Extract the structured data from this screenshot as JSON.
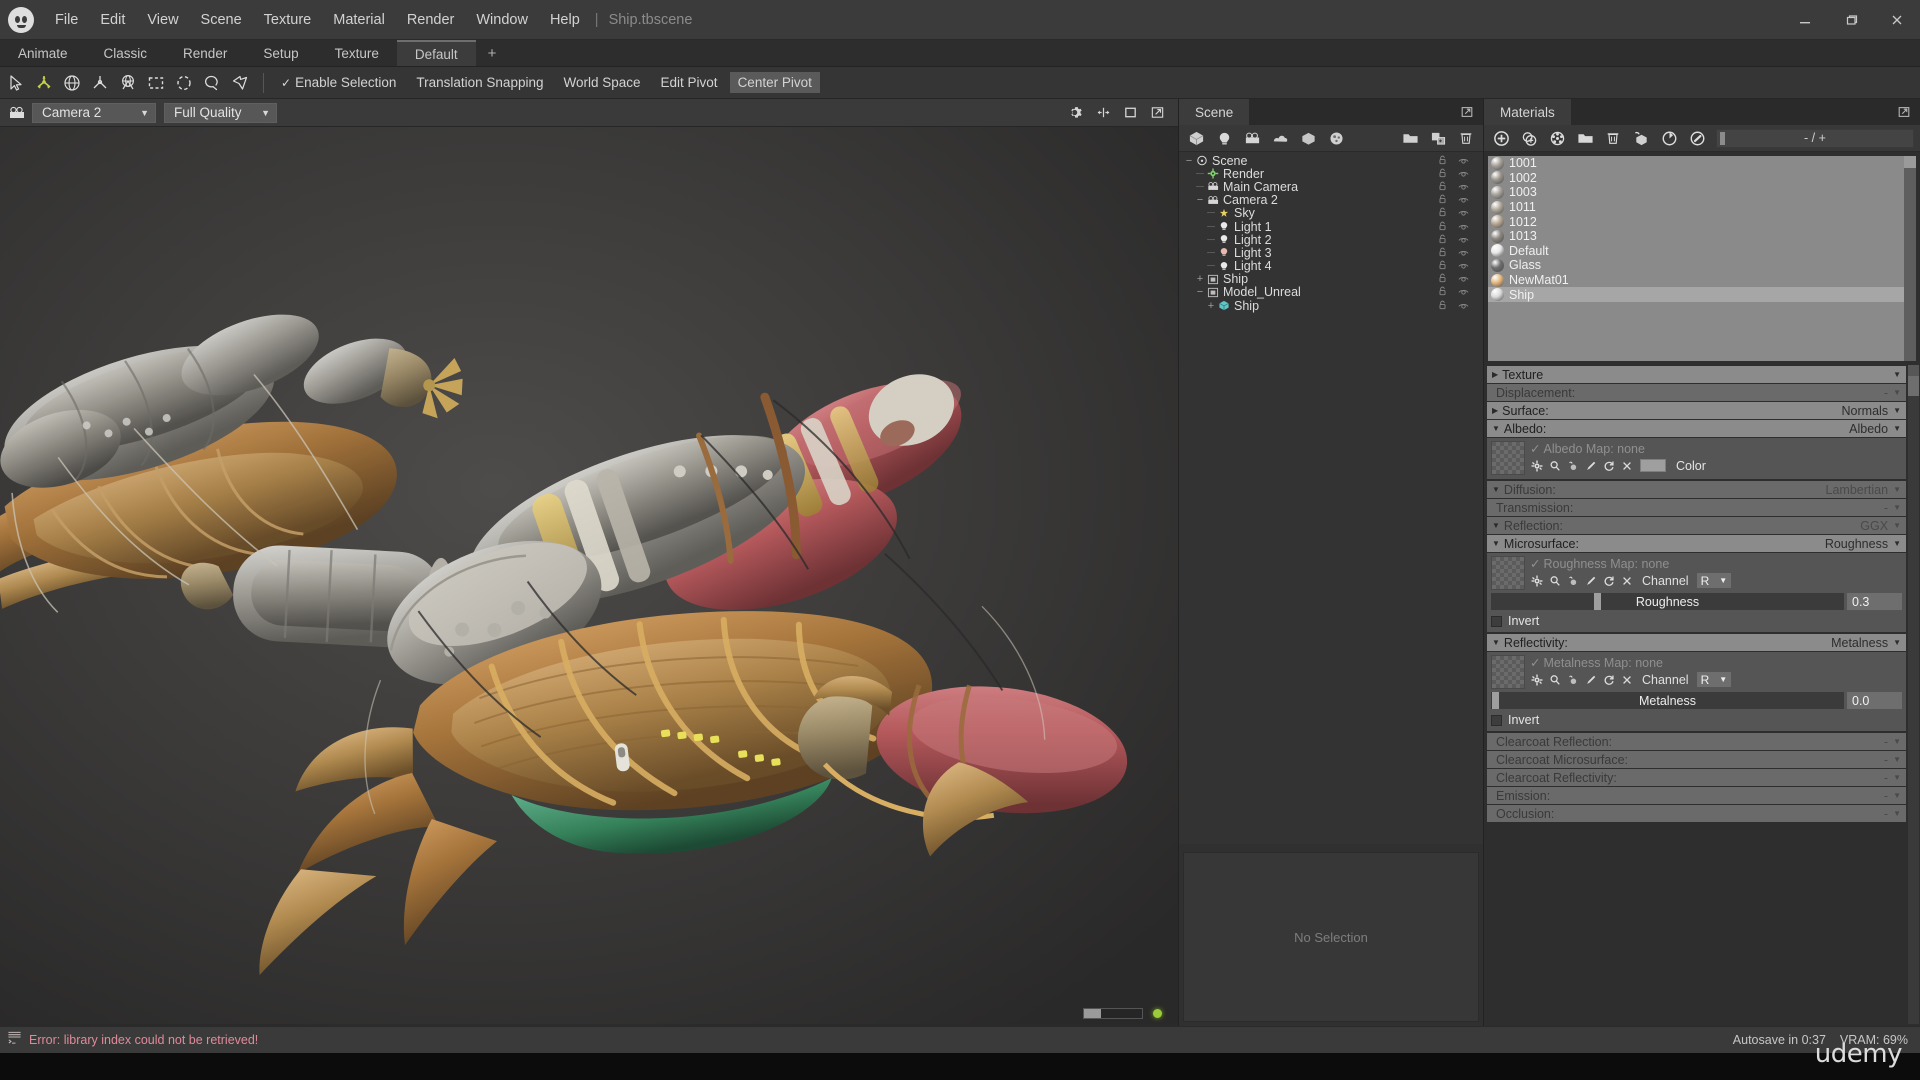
{
  "app": {
    "title": "Ship.tbscene",
    "separator": "|"
  },
  "menubar": {
    "items": [
      "File",
      "Edit",
      "View",
      "Scene",
      "Texture",
      "Material",
      "Render",
      "Window",
      "Help"
    ]
  },
  "window_controls": {
    "minimize": "minimize-icon",
    "maximize": "maximize-icon",
    "close": "close-icon"
  },
  "layout_tabs": {
    "items": [
      "Animate",
      "Classic",
      "Render",
      "Setup",
      "Texture",
      "Default"
    ],
    "active": "Default",
    "add_label": "+"
  },
  "toolbar": {
    "tools": [
      {
        "name": "select-arrow-tool",
        "icon": "cursor-arrow-icon"
      },
      {
        "name": "translate-tool",
        "icon": "translate-axis-icon"
      },
      {
        "name": "rotate-tool",
        "icon": "rotate-globe-icon"
      },
      {
        "name": "scale-tool",
        "icon": "scale-icon"
      },
      {
        "name": "transform-tool",
        "icon": "transform-globe-icon"
      },
      {
        "name": "rect-select-tool",
        "icon": "rectangle-marquee-icon"
      },
      {
        "name": "ellipse-select-tool",
        "icon": "ellipse-marquee-icon"
      },
      {
        "name": "lasso-select-tool",
        "icon": "lasso-icon"
      },
      {
        "name": "polygon-select-tool",
        "icon": "polygon-lasso-icon"
      }
    ],
    "toggles": [
      {
        "label": "Enable Selection",
        "checked": true,
        "pressed": false
      },
      {
        "label": "Translation Snapping",
        "checked": false,
        "pressed": false
      },
      {
        "label": "World Space",
        "checked": false,
        "pressed": false
      },
      {
        "label": "Edit Pivot",
        "checked": false,
        "pressed": false
      },
      {
        "label": "Center Pivot",
        "checked": false,
        "pressed": true
      }
    ]
  },
  "viewport": {
    "camera_select": {
      "value": "Camera 2",
      "caret": "▼"
    },
    "quality_select": {
      "value": "Full Quality",
      "caret": "▼"
    },
    "header_icons": [
      "gear-icon",
      "split-view-icon",
      "square-icon",
      "popout-icon"
    ],
    "progress_percent": 30,
    "status_dot_color": "#9ccc3a"
  },
  "scene_panel": {
    "tab_label": "Scene",
    "toolbar_icons": [
      "add-mesh-icon",
      "add-light-icon",
      "add-camera-icon",
      "add-sky-icon",
      "add-object-icon",
      "add-material-icon",
      "folder-icon",
      "duplicate-icon",
      "trash-icon"
    ],
    "tree": [
      {
        "label": "Scene",
        "depth": 0,
        "toggle": "−",
        "icon": "scene-root-icon",
        "iconColor": "#d9d9d9"
      },
      {
        "label": "Render",
        "depth": 1,
        "toggle": "",
        "icon": "render-gear-icon",
        "iconColor": "#7fd46b"
      },
      {
        "label": "Main Camera",
        "depth": 1,
        "toggle": "",
        "icon": "camera-icon",
        "iconColor": "#d6d6d6"
      },
      {
        "label": "Camera 2",
        "depth": 1,
        "toggle": "−",
        "icon": "camera-icon",
        "iconColor": "#d6d6d6"
      },
      {
        "label": "Sky",
        "depth": 2,
        "toggle": "",
        "icon": "sky-icon",
        "iconColor": "#e8d060"
      },
      {
        "label": "Light 1",
        "depth": 2,
        "toggle": "",
        "icon": "light-bulb-icon",
        "iconColor": "#e9e9e9"
      },
      {
        "label": "Light 2",
        "depth": 2,
        "toggle": "",
        "icon": "light-bulb-icon",
        "iconColor": "#e9e9e9"
      },
      {
        "label": "Light 3",
        "depth": 2,
        "toggle": "",
        "icon": "light-bulb-icon",
        "iconColor": "#e8b9b0"
      },
      {
        "label": "Light 4",
        "depth": 2,
        "toggle": "",
        "icon": "light-bulb-icon",
        "iconColor": "#e9e9e9"
      },
      {
        "label": "Ship",
        "depth": 1,
        "toggle": "+",
        "icon": "group-icon",
        "iconColor": "#bdbdbd"
      },
      {
        "label": "Model_Unreal",
        "depth": 1,
        "toggle": "−",
        "icon": "group-icon",
        "iconColor": "#bdbdbd"
      },
      {
        "label": "Ship",
        "depth": 2,
        "toggle": "+",
        "icon": "mesh-cube-icon",
        "iconColor": "#5ec8c8"
      }
    ],
    "row_icons": {
      "lock": "lock-icon",
      "visibility": "eye-icon"
    },
    "properties_empty": "No Selection"
  },
  "materials_panel": {
    "tab_label": "Materials",
    "toolbar_icons": [
      "add-material-icon",
      "duplicate-material-icon",
      "clear-material-icon",
      "folder-icon",
      "trash-icon",
      "assign-material-icon",
      "preview-sphere-icon",
      "refresh-icon"
    ],
    "search_placeholder": "",
    "counter": "- / +",
    "materials": [
      {
        "label": "1001",
        "color": "#a8a29a",
        "selected": false
      },
      {
        "label": "1002",
        "color": "#9d978e",
        "selected": false
      },
      {
        "label": "1003",
        "color": "#a7a29c",
        "selected": false
      },
      {
        "label": "1011",
        "color": "#b2a99c",
        "selected": false
      },
      {
        "label": "1012",
        "color": "#b9a995",
        "selected": false
      },
      {
        "label": "1013",
        "color": "#8d8880",
        "selected": false
      },
      {
        "label": "Default",
        "color": "#e9e9e9",
        "selected": false
      },
      {
        "label": "Glass",
        "color": "#6f6f6f",
        "selected": false
      },
      {
        "label": "NewMat01",
        "color": "#e6b87f",
        "selected": false
      },
      {
        "label": "Ship",
        "color": "#dcdcdc",
        "selected": true
      }
    ],
    "sections": [
      {
        "key": "texture",
        "title": "Texture",
        "tri": "▶",
        "value": "",
        "dim": false,
        "expanded": false
      },
      {
        "key": "displace",
        "title": "Displacement:",
        "tri": "",
        "value": "-",
        "dim": true,
        "expanded": false
      },
      {
        "key": "surface",
        "title": "Surface:",
        "tri": "▶",
        "value": "Normals",
        "dim": false,
        "expanded": false
      },
      {
        "key": "albedo",
        "title": "Albedo:",
        "tri": "▼",
        "value": "Albedo",
        "dim": false,
        "expanded": true
      },
      {
        "key": "diffusion",
        "title": "Diffusion:",
        "tri": "▼",
        "value": "Lambertian",
        "dim": true,
        "expanded": false
      },
      {
        "key": "transmis",
        "title": "Transmission:",
        "tri": "",
        "value": "-",
        "dim": true,
        "expanded": false
      },
      {
        "key": "reflection",
        "title": "Reflection:",
        "tri": "▼",
        "value": "GGX",
        "dim": true,
        "expanded": false
      },
      {
        "key": "micro",
        "title": "Microsurface:",
        "tri": "▼",
        "value": "Roughness",
        "dim": false,
        "expanded": true
      },
      {
        "key": "reflectiv",
        "title": "Reflectivity:",
        "tri": "▼",
        "value": "Metalness",
        "dim": false,
        "expanded": true
      },
      {
        "key": "ccrefl",
        "title": "Clearcoat Reflection:",
        "tri": "",
        "value": "-",
        "dim": true,
        "expanded": false
      },
      {
        "key": "ccmicro",
        "title": "Clearcoat Microsurface:",
        "tri": "",
        "value": "-",
        "dim": true,
        "expanded": false
      },
      {
        "key": "ccreflect",
        "title": "Clearcoat Reflectivity:",
        "tri": "",
        "value": "-",
        "dim": true,
        "expanded": false
      },
      {
        "key": "emission",
        "title": "Emission:",
        "tri": "",
        "value": "-",
        "dim": true,
        "expanded": false
      },
      {
        "key": "occlusion",
        "title": "Occlusion:",
        "tri": "",
        "value": "-",
        "dim": true,
        "expanded": false
      }
    ],
    "albedo_body": {
      "map_label": "Albedo Map: none",
      "check": "✓",
      "icons": [
        "gear-icon",
        "search-icon",
        "eyedropper-icon",
        "edit-pencil-icon",
        "reload-icon",
        "clear-x-icon"
      ],
      "color_label": "Color",
      "color_value": "#9f9f9f"
    },
    "micro_body": {
      "map_label": "Roughness Map: none",
      "check": "✓",
      "icons": [
        "gear-icon",
        "search-icon",
        "eyedropper-icon",
        "edit-pencil-icon",
        "reload-icon",
        "clear-x-icon"
      ],
      "channel_label": "Channel",
      "channel_value": "R",
      "slider_label": "Roughness",
      "slider_value": "0.3",
      "slider_percent": 30,
      "invert_label": "Invert",
      "invert_checked": false
    },
    "reflectiv_body": {
      "map_label": "Metalness Map: none",
      "check": "✓",
      "icons": [
        "gear-icon",
        "search-icon",
        "eyedropper-icon",
        "edit-pencil-icon",
        "reload-icon",
        "clear-x-icon"
      ],
      "channel_label": "Channel",
      "channel_value": "R",
      "slider_label": "Metalness",
      "slider_value": "0.0",
      "slider_percent": 1,
      "invert_label": "Invert",
      "invert_checked": false
    }
  },
  "statusbar": {
    "error_icon": "console-icon",
    "error_text": "Error: library index could not be retrieved!",
    "autosave": "Autosave in 0:37",
    "vram": "VRAM: 69%"
  },
  "footer": {
    "watermark": "udemy"
  },
  "colors": {
    "accent_green": "#9ccc3a",
    "error_pink": "#e08a9a",
    "panel_bg": "#303030",
    "titlebar_bg": "#3b3b3b",
    "section_header": "#8b8b8b"
  }
}
